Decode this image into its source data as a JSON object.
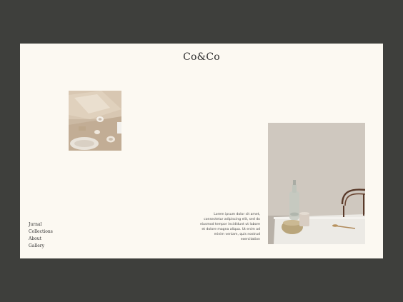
{
  "brand": {
    "name": "Co&Co"
  },
  "nav": {
    "items": [
      {
        "label": "Jurnal"
      },
      {
        "label": "Collections"
      },
      {
        "label": "About"
      },
      {
        "label": "Gallery"
      }
    ]
  },
  "blurb": {
    "lines": [
      "Lorem ipsum dolor sit amet,",
      "consectetur adipiscing elit, sed do",
      "eiusmod tempor incididunt ut labore",
      "et dolore magna aliqua. Ut enim ad",
      "minim veniam, quis nostrud",
      "exercitation"
    ]
  },
  "colors": {
    "backdrop": "#3e3f3c",
    "page": "#fcf9f2",
    "text": "#2b2b2b"
  }
}
